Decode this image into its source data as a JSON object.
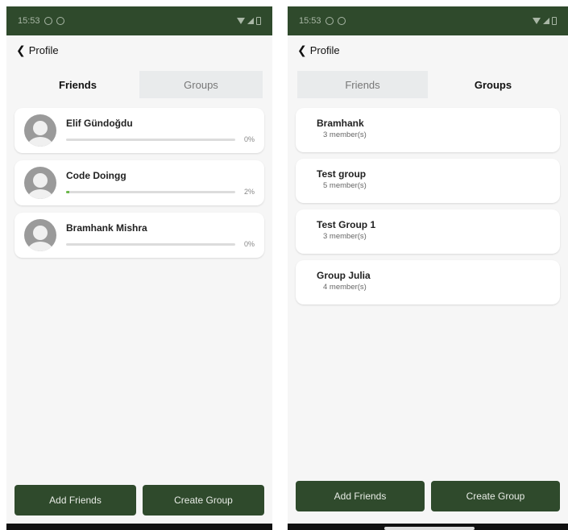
{
  "left": {
    "status": {
      "time": "15:53"
    },
    "nav": {
      "back_label": "Profile"
    },
    "tabs": [
      {
        "label": "Friends",
        "active": true
      },
      {
        "label": "Groups",
        "active": false
      }
    ],
    "friends": [
      {
        "name": "Elif Gündoğdu",
        "progress": 0,
        "progress_label": "0%"
      },
      {
        "name": "Code Doingg",
        "progress": 2,
        "progress_label": "2%"
      },
      {
        "name": "Bramhank Mishra",
        "progress": 0,
        "progress_label": "0%"
      }
    ],
    "actions": {
      "add_friends": "Add Friends",
      "create_group": "Create Group"
    }
  },
  "right": {
    "status": {
      "time": "15:53"
    },
    "nav": {
      "back_label": "Profile"
    },
    "tabs": [
      {
        "label": "Friends",
        "active": false
      },
      {
        "label": "Groups",
        "active": true
      }
    ],
    "groups": [
      {
        "name": "Bramhank",
        "members": "3 member(s)"
      },
      {
        "name": "Test group",
        "members": "5 member(s)"
      },
      {
        "name": "Test Group 1",
        "members": "3 member(s)"
      },
      {
        "name": "Group Julia",
        "members": "4 member(s)"
      }
    ],
    "actions": {
      "add_friends": "Add Friends",
      "create_group": "Create Group"
    }
  },
  "colors": {
    "primary": "#2f4a2c",
    "progress": "#6cb84a",
    "tab_inactive": "#e9ebec"
  },
  "icons": {
    "back": "chevron-left-icon",
    "avatar": "user-placeholder-icon"
  }
}
